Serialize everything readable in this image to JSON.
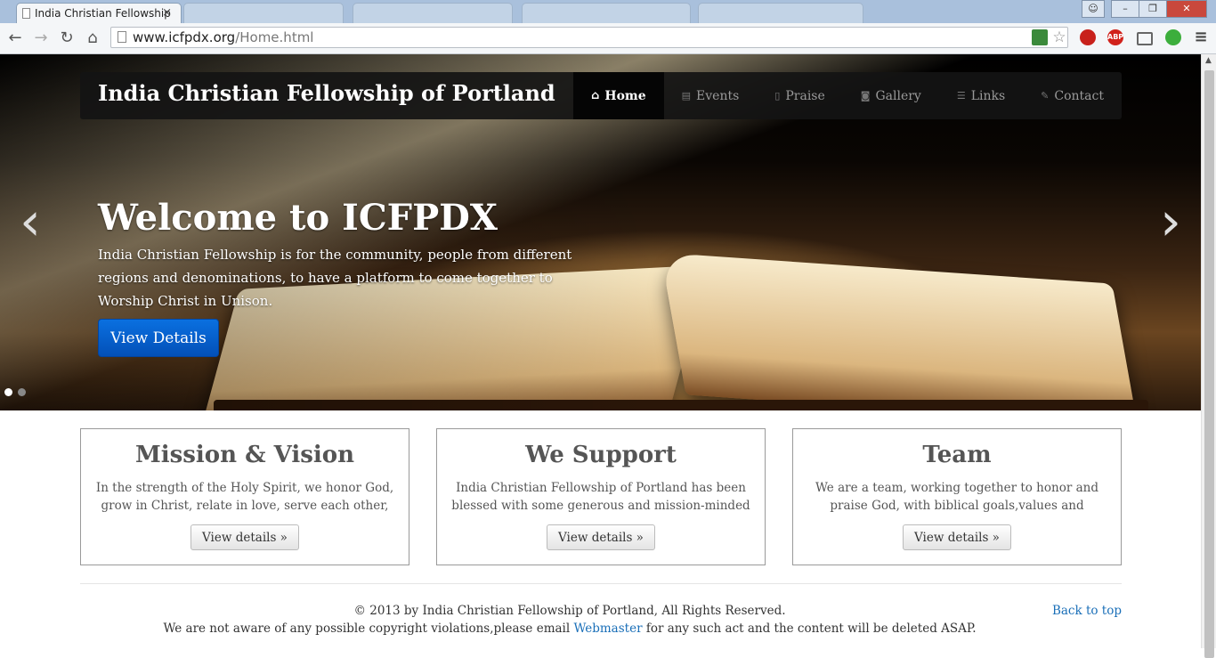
{
  "browser": {
    "tabs": [
      {
        "label": "India Christian Fellowship",
        "active": true
      },
      {
        "label": "",
        "active": false
      },
      {
        "label": "",
        "active": false
      },
      {
        "label": "",
        "active": false
      },
      {
        "label": "",
        "active": false
      }
    ],
    "close_glyph": "×",
    "url_host": "www.icfpdx.org",
    "url_path": "/Home.html",
    "extensions": [
      "ABP"
    ]
  },
  "site": {
    "brand": "India Christian Fellowship of Portland",
    "nav": [
      {
        "label": "Home",
        "icon": "home-icon"
      },
      {
        "label": "Events",
        "icon": "list-icon"
      },
      {
        "label": "Praise",
        "icon": "book-icon"
      },
      {
        "label": "Gallery",
        "icon": "camera-icon"
      },
      {
        "label": "Links",
        "icon": "list-icon"
      },
      {
        "label": "Contact",
        "icon": "pencil-icon"
      }
    ],
    "hero": {
      "title": "Welcome to ICFPDX",
      "text": "India Christian Fellowship is for the community, people from different regions and denominations, to have a platform to come together to Worship Christ in Unison.",
      "button": "View Details",
      "prev": "‹",
      "next": "›"
    },
    "features": [
      {
        "title": "Mission & Vision",
        "text": "In the strength of the Holy Spirit, we honor God, grow in Christ, relate in love, serve each other, and connect…",
        "button": "View details »"
      },
      {
        "title": "We Support",
        "text": "India Christian Fellowship of Portland has been blessed with some generous and mission-minded members!",
        "button": "View details »"
      },
      {
        "title": "Team",
        "text": "We are a team, working together to honor and praise God, with biblical goals,values and responsibilities",
        "button": "View details »"
      }
    ],
    "footer": {
      "copyright": "© 2013 by India Christian Fellowship of Portland, All Rights Reserved.",
      "notice_pre": "We are not aware of any possible copyright violations,please email ",
      "notice_link": "Webmaster",
      "notice_post": " for any such act and the content will be deleted ASAP.",
      "back_to_top": "Back to top"
    }
  },
  "colors": {
    "cta": "#0a64d4",
    "link": "#1a6fb8",
    "nav_bg": "#141414"
  }
}
